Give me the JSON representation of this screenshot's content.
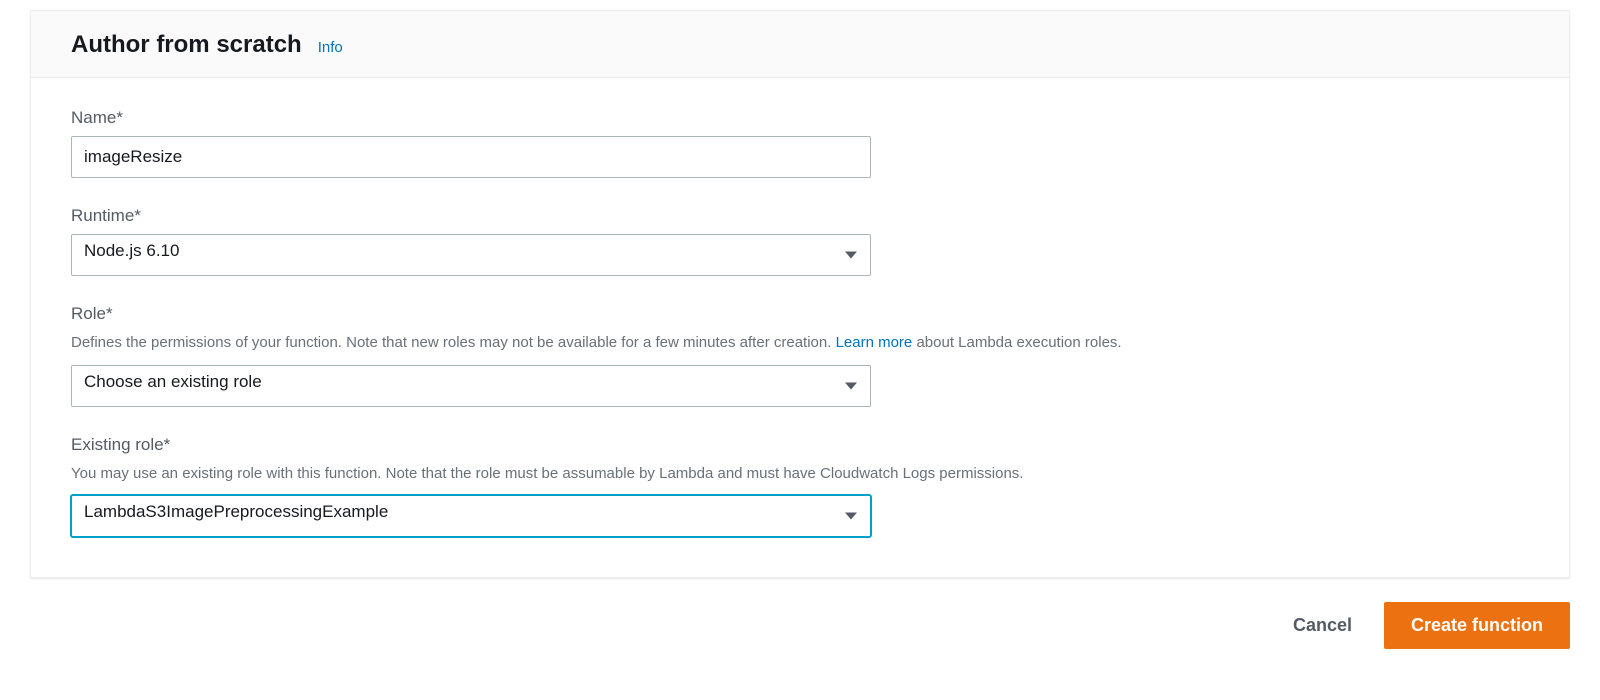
{
  "header": {
    "title": "Author from scratch",
    "info": "Info"
  },
  "form": {
    "name": {
      "label": "Name*",
      "value": "imageResize"
    },
    "runtime": {
      "label": "Runtime*",
      "value": "Node.js 6.10"
    },
    "role": {
      "label": "Role*",
      "help_before": "Defines the permissions of your function. Note that new roles may not be available for a few minutes after creation. ",
      "help_link": "Learn more",
      "help_after": " about Lambda execution roles.",
      "value": "Choose an existing role"
    },
    "existing_role": {
      "label": "Existing role*",
      "help": "You may use an existing role with this function. Note that the role must be assumable by Lambda and must have Cloudwatch Logs permissions.",
      "value": "LambdaS3ImagePreprocessingExample"
    }
  },
  "footer": {
    "cancel": "Cancel",
    "create": "Create function"
  }
}
